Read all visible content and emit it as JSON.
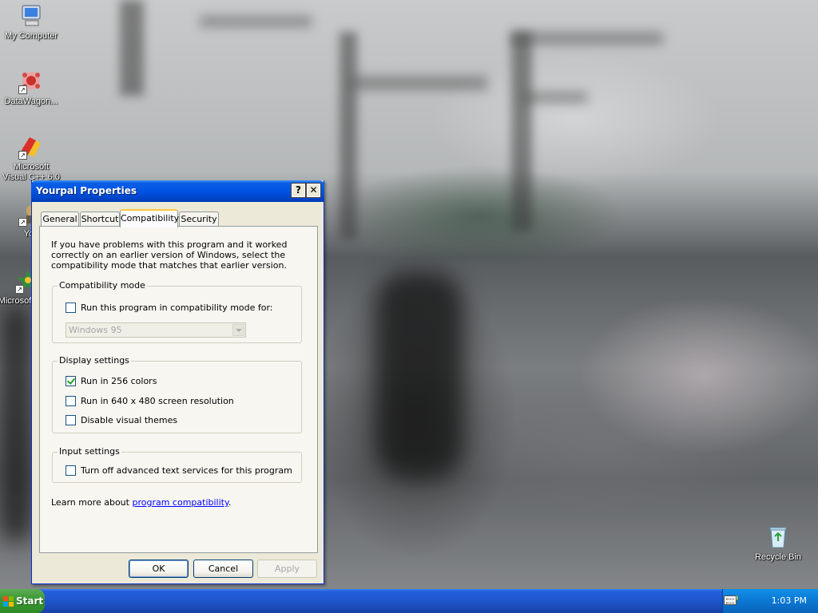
{
  "desktop": {
    "icons": [
      {
        "label": "My Computer",
        "icon": "my-computer-icon"
      },
      {
        "label": "DataWagon...",
        "icon": "datawagon-icon"
      },
      {
        "label": "Microsoft Visual C++ 6.0",
        "icon": "visual-cpp-icon"
      },
      {
        "label": "You",
        "icon": "yourpal-icon"
      },
      {
        "label": "Microsoft Basic",
        "icon": "visual-basic-icon"
      },
      {
        "label": "Recycle Bin",
        "icon": "recycle-bin-icon"
      }
    ]
  },
  "dialog": {
    "title": "Yourpal Properties",
    "help_button": "?",
    "close_button": "✕",
    "tabs": [
      {
        "label": "General",
        "active": false
      },
      {
        "label": "Shortcut",
        "active": false
      },
      {
        "label": "Compatibility",
        "active": true
      },
      {
        "label": "Security",
        "active": false
      }
    ],
    "intro_text": "If you have problems with this program and it worked correctly on an earlier version of Windows, select the compatibility mode that matches that earlier version.",
    "compatibility_mode": {
      "legend": "Compatibility mode",
      "checkbox_label": "Run this program in compatibility mode for:",
      "checked": false,
      "select_value": "Windows 95",
      "select_enabled": false
    },
    "display_settings": {
      "legend": "Display settings",
      "options": [
        {
          "label": "Run in 256 colors",
          "checked": true
        },
        {
          "label": "Run in 640 x 480 screen resolution",
          "checked": false
        },
        {
          "label": "Disable visual themes",
          "checked": false
        }
      ]
    },
    "input_settings": {
      "legend": "Input settings",
      "checkbox_label": "Turn off advanced text services for this program",
      "checked": false
    },
    "learn_more_prefix": "Learn more about ",
    "learn_more_link": "program compatibility",
    "learn_more_suffix": ".",
    "buttons": {
      "ok": "OK",
      "cancel": "Cancel",
      "apply": "Apply"
    }
  },
  "taskbar": {
    "start_label": "Start",
    "clock": "1:03 PM"
  },
  "colors": {
    "title_bar": "#0054e3",
    "taskbar": "#245edb",
    "start_button": "#3c9b35",
    "dialog_face": "#ece9d8",
    "link": "#0000ff"
  }
}
